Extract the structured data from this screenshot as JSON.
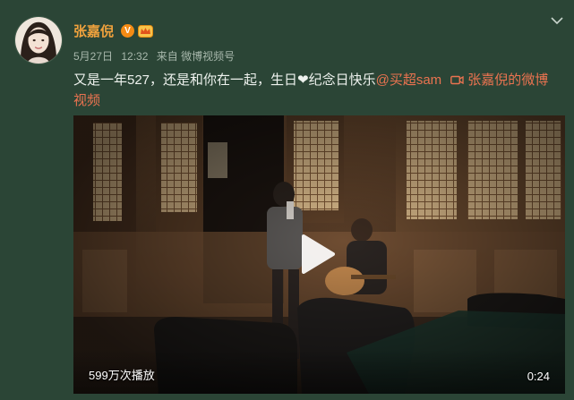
{
  "user": {
    "name": "张嘉倪",
    "verified_badge": "V",
    "avatar_icon": "avatar-photo"
  },
  "meta": {
    "date": "5月27日",
    "time": "12:32",
    "source": "来自 微博视频号"
  },
  "post": {
    "text": "又是一年527，还是和你在一起，生日❤纪念日快乐",
    "mention": "@买超sam",
    "video_link": "张嘉倪的微博视频",
    "video_link_icon": "video-camera-icon"
  },
  "video": {
    "views": "599万次播放",
    "duration": "0:24",
    "play_icon": "play-icon"
  },
  "colors": {
    "background": "#2b4536",
    "username": "#f0a23d",
    "link": "#eb7350"
  }
}
